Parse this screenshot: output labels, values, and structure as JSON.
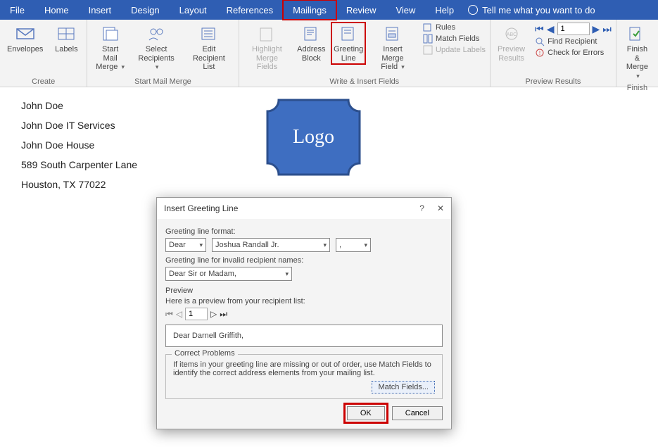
{
  "menubar": {
    "tabs": [
      "File",
      "Home",
      "Insert",
      "Design",
      "Layout",
      "References",
      "Mailings",
      "Review",
      "View",
      "Help"
    ],
    "active_index": 6,
    "search_placeholder": "Tell me what you want to do"
  },
  "ribbon": {
    "groups": {
      "create": {
        "label": "Create",
        "envelopes": "Envelopes",
        "labels": "Labels"
      },
      "startmm": {
        "label": "Start Mail Merge",
        "start": "Start Mail Merge",
        "select": "Select Recipients",
        "edit": "Edit Recipient List"
      },
      "write": {
        "label": "Write & Insert Fields",
        "highlight": "Highlight Merge Fields",
        "address": "Address Block",
        "greeting": "Greeting Line",
        "insertmerge": "Insert Merge Field",
        "rules": "Rules",
        "match": "Match Fields",
        "update": "Update Labels"
      },
      "preview": {
        "label": "Preview Results",
        "preview": "Preview Results",
        "record": "1",
        "find": "Find Recipient",
        "check": "Check for Errors"
      },
      "finish": {
        "label": "Finish",
        "finish": "Finish & Merge"
      }
    }
  },
  "document": {
    "lines": [
      "John Doe",
      "John Doe IT Services",
      "John Doe House",
      "589 South Carpenter Lane",
      "Houston, TX 77022"
    ],
    "logo_text": "Logo"
  },
  "dialog": {
    "title": "Insert Greeting Line",
    "format_label": "Greeting line format:",
    "format_greeting": "Dear",
    "format_name": "Joshua Randall Jr.",
    "format_punct": ",",
    "invalid_label": "Greeting line for invalid recipient names:",
    "invalid_value": "Dear Sir or Madam,",
    "preview_label": "Preview",
    "preview_hint": "Here is a preview from your recipient list:",
    "preview_index": "1",
    "preview_text": "Dear Darnell Griffith,",
    "problems_legend": "Correct Problems",
    "problems_text": "If items in your greeting line are missing or out of order, use Match Fields to identify the correct address elements from your mailing list.",
    "match_btn": "Match Fields...",
    "ok": "OK",
    "cancel": "Cancel"
  }
}
